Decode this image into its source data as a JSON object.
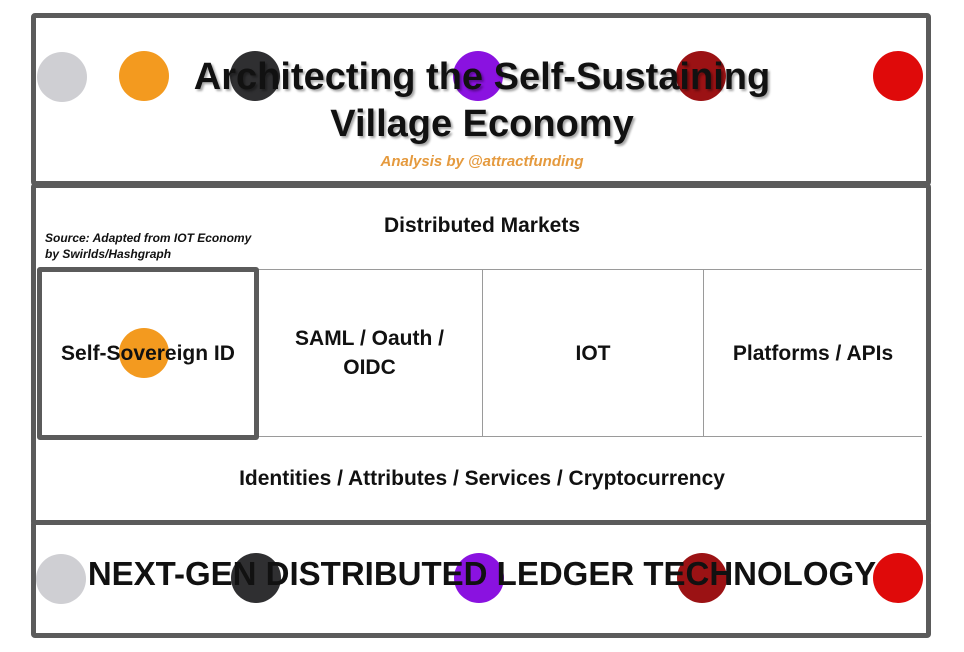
{
  "header": {
    "title_line1": "Architecting the Self-Sustaining",
    "title_line2": "Village Economy",
    "subtitle": "Analysis by @attractfunding"
  },
  "diagram": {
    "top_layer": "Distributed Markets",
    "source_note": "Source: Adapted from IOT Economy by Swirlds/Hashgraph",
    "middle_layer": [
      {
        "label": "Self-Sovereign ID"
      },
      {
        "label": "SAML / Oauth / OIDC"
      },
      {
        "label": "IOT"
      },
      {
        "label": "Platforms / APIs"
      }
    ],
    "base_layer": "Identities / Attributes / Services / Cryptocurrency",
    "foundation": "NEXT-GEN DISTRIBUTED LEDGER TECHNOLOGY"
  },
  "colors": {
    "frame": "#5b5b5b",
    "dot_gray": "#cfcfd3",
    "dot_orange": "#f39a1f",
    "dot_dark": "#2f2f31",
    "dot_purple": "#8a12e0",
    "dot_maroon": "#9b1214",
    "dot_red": "#df0a0a",
    "subtitle": "#e59a3e"
  }
}
